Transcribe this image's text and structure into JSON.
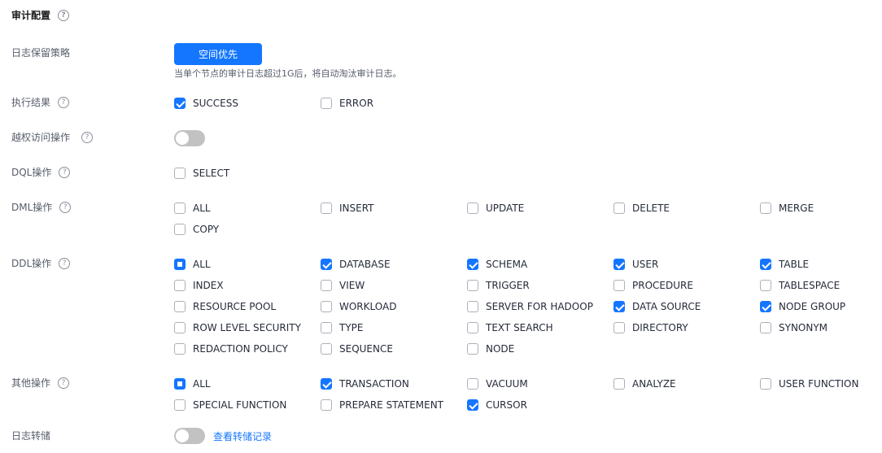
{
  "section": {
    "title": "审计配置"
  },
  "retention": {
    "label": "日志保留策略",
    "button": "空间优先",
    "hint": "当单个节点的审计日志超过1G后，将自动淘汰审计日志。"
  },
  "exec_result": {
    "label": "执行结果",
    "items": [
      {
        "label": "SUCCESS",
        "state": "checked"
      },
      {
        "label": "ERROR",
        "state": "unchecked"
      }
    ]
  },
  "privilege": {
    "label": "越权访问操作",
    "enabled": false
  },
  "dql": {
    "label": "DQL操作",
    "items": [
      {
        "label": "SELECT",
        "state": "unchecked"
      }
    ]
  },
  "dml": {
    "label": "DML操作",
    "items": [
      {
        "label": "ALL",
        "state": "unchecked"
      },
      {
        "label": "INSERT",
        "state": "unchecked"
      },
      {
        "label": "UPDATE",
        "state": "unchecked"
      },
      {
        "label": "DELETE",
        "state": "unchecked"
      },
      {
        "label": "MERGE",
        "state": "unchecked"
      },
      {
        "label": "COPY",
        "state": "unchecked"
      }
    ]
  },
  "ddl": {
    "label": "DDL操作",
    "items": [
      {
        "label": "ALL",
        "state": "indeterminate"
      },
      {
        "label": "DATABASE",
        "state": "checked"
      },
      {
        "label": "SCHEMA",
        "state": "checked"
      },
      {
        "label": "USER",
        "state": "checked"
      },
      {
        "label": "TABLE",
        "state": "checked"
      },
      {
        "label": "INDEX",
        "state": "unchecked"
      },
      {
        "label": "VIEW",
        "state": "unchecked"
      },
      {
        "label": "TRIGGER",
        "state": "unchecked"
      },
      {
        "label": "PROCEDURE",
        "state": "unchecked"
      },
      {
        "label": "TABLESPACE",
        "state": "unchecked"
      },
      {
        "label": "RESOURCE POOL",
        "state": "unchecked"
      },
      {
        "label": "WORKLOAD",
        "state": "unchecked"
      },
      {
        "label": "SERVER FOR HADOOP",
        "state": "unchecked"
      },
      {
        "label": "DATA SOURCE",
        "state": "checked"
      },
      {
        "label": "NODE GROUP",
        "state": "checked"
      },
      {
        "label": "ROW LEVEL SECURITY",
        "state": "unchecked"
      },
      {
        "label": "TYPE",
        "state": "unchecked"
      },
      {
        "label": "TEXT SEARCH",
        "state": "unchecked"
      },
      {
        "label": "DIRECTORY",
        "state": "unchecked"
      },
      {
        "label": "SYNONYM",
        "state": "unchecked"
      },
      {
        "label": "REDACTION POLICY",
        "state": "unchecked"
      },
      {
        "label": "SEQUENCE",
        "state": "unchecked"
      },
      {
        "label": "NODE",
        "state": "unchecked"
      }
    ]
  },
  "other": {
    "label": "其他操作",
    "items": [
      {
        "label": "ALL",
        "state": "indeterminate"
      },
      {
        "label": "TRANSACTION",
        "state": "checked"
      },
      {
        "label": "VACUUM",
        "state": "unchecked"
      },
      {
        "label": "ANALYZE",
        "state": "unchecked"
      },
      {
        "label": "USER FUNCTION",
        "state": "unchecked"
      },
      {
        "label": "SPECIAL FUNCTION",
        "state": "unchecked"
      },
      {
        "label": "PREPARE STATEMENT",
        "state": "unchecked"
      },
      {
        "label": "CURSOR",
        "state": "checked"
      }
    ]
  },
  "dump": {
    "label": "日志转储",
    "enabled": false,
    "link": "查看转储记录"
  },
  "help_glyph": "?",
  "colors": {
    "primary": "#1476ff",
    "toggle_off": "#c2c2c2"
  }
}
